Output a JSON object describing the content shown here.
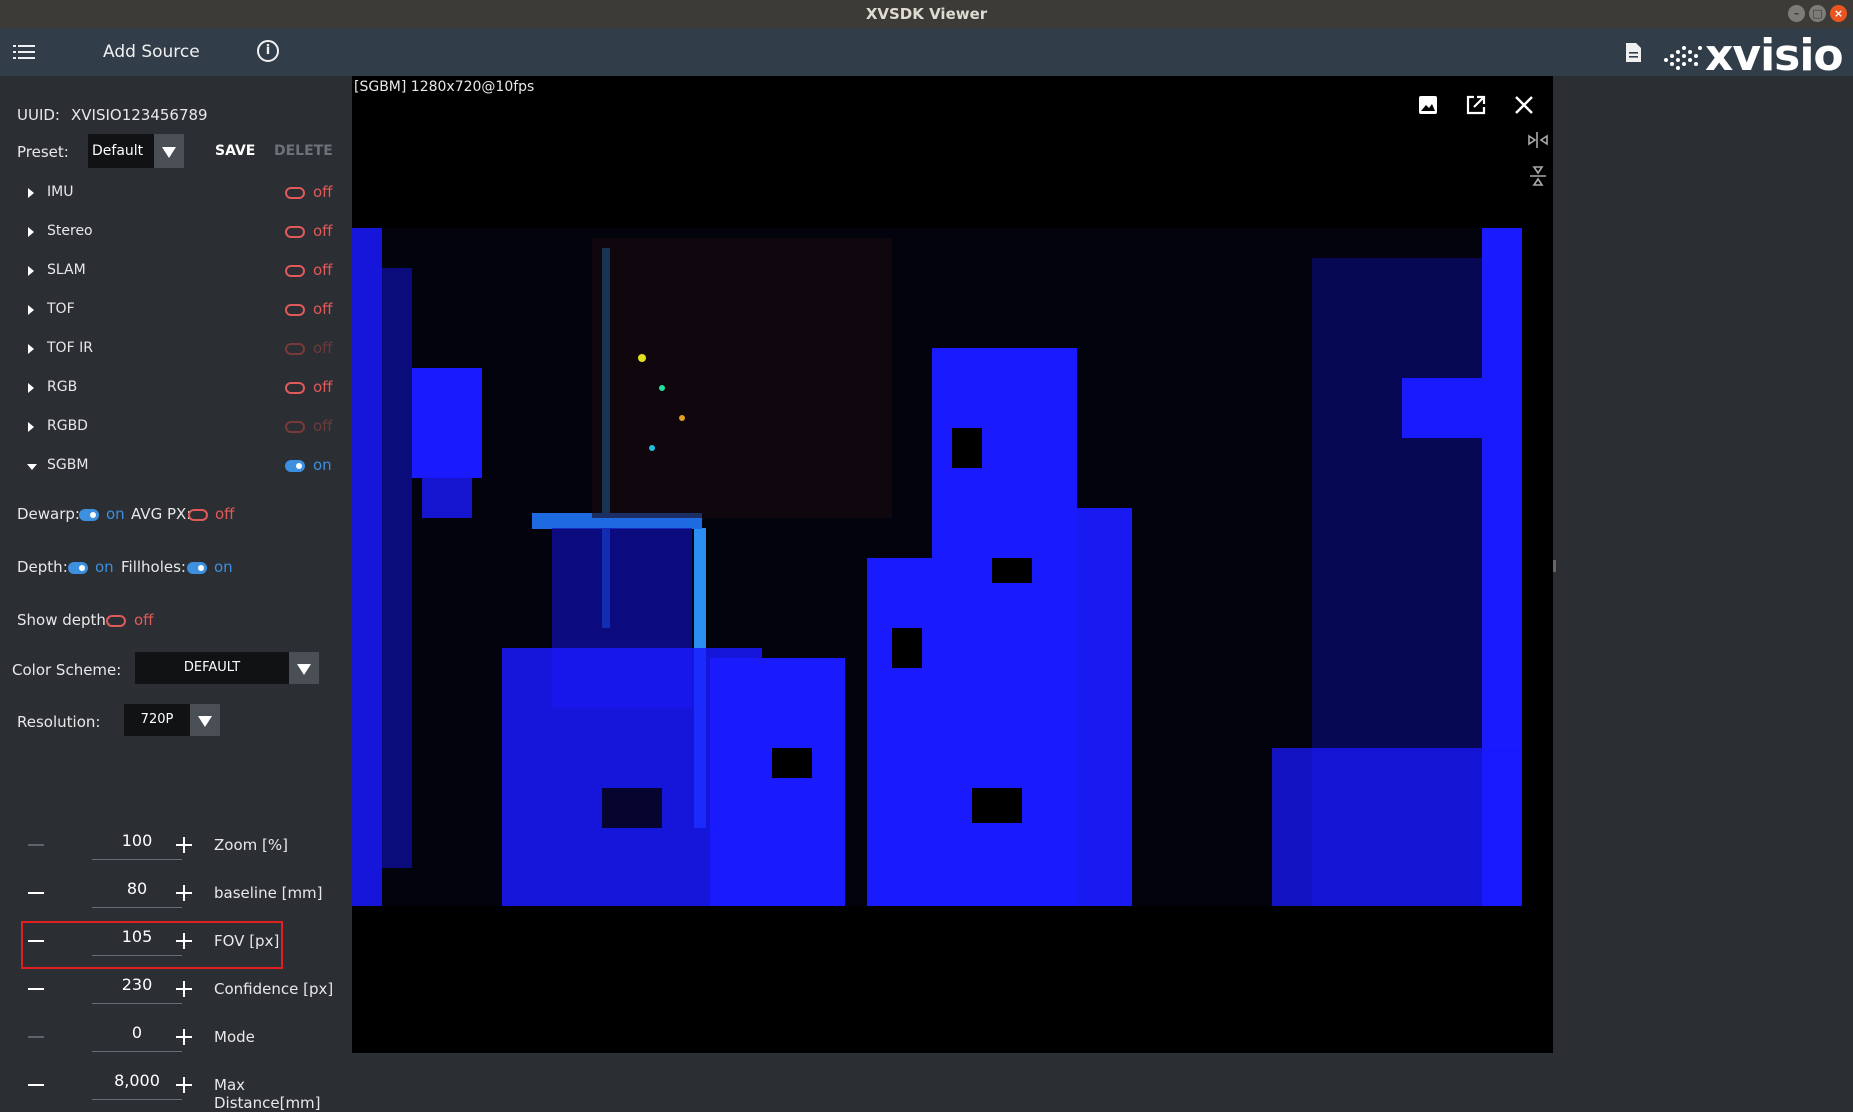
{
  "window": {
    "title": "XVSDK Viewer"
  },
  "appbar": {
    "add_source_label": "Add Source",
    "logo_text": "xvisio"
  },
  "device": {
    "uuid_label": "UUID:",
    "uuid_value": "XVISIO123456789"
  },
  "preset": {
    "label": "Preset:",
    "value": "Default",
    "save_label": "SAVE",
    "delete_label": "DELETE"
  },
  "modules": [
    {
      "name": "IMU",
      "state": "off",
      "enabled": false,
      "available": true
    },
    {
      "name": "Stereo",
      "state": "off",
      "enabled": false,
      "available": true
    },
    {
      "name": "SLAM",
      "state": "off",
      "enabled": false,
      "available": true
    },
    {
      "name": "TOF",
      "state": "off",
      "enabled": false,
      "available": true
    },
    {
      "name": "TOF IR",
      "state": "off",
      "enabled": false,
      "available": false
    },
    {
      "name": "RGB",
      "state": "off",
      "enabled": false,
      "available": true
    },
    {
      "name": "RGBD",
      "state": "off",
      "enabled": false,
      "available": false
    },
    {
      "name": "SGBM",
      "state": "on",
      "enabled": true,
      "available": true,
      "expanded": true
    }
  ],
  "sgbm": {
    "dewarp": {
      "label": "Dewarp:",
      "state": "on"
    },
    "avg_px": {
      "label": "AVG PX:",
      "state": "off"
    },
    "depth": {
      "label": "Depth:",
      "state": "on"
    },
    "fillholes": {
      "label": "Fillholes:",
      "state": "on"
    },
    "show_depth": {
      "label": "Show depth:",
      "state": "off"
    },
    "color_scheme": {
      "label": "Color Scheme:",
      "value": "DEFAULT"
    },
    "resolution": {
      "label": "Resolution:",
      "value": "720P"
    },
    "steppers": [
      {
        "value": "100",
        "label": "Zoom [%]",
        "minus_enabled": false
      },
      {
        "value": "80",
        "label": "baseline [mm]",
        "minus_enabled": true
      },
      {
        "value": "105",
        "label": "FOV [px]",
        "minus_enabled": true,
        "highlighted": true
      },
      {
        "value": "230",
        "label": "Confidence [px]",
        "minus_enabled": true
      },
      {
        "value": "0",
        "label": "Mode",
        "minus_enabled": false
      },
      {
        "value": "8,000",
        "label": "Max Distance[mm]",
        "minus_enabled": true
      }
    ]
  },
  "viewer": {
    "stream_info": "[SGBM]  1280x720@10fps"
  },
  "colors": {
    "accent_on": "#3d8fe0",
    "state_off": "#e05a5a",
    "highlight_box": "#e02020",
    "depth_blue": "#1a1aff"
  }
}
